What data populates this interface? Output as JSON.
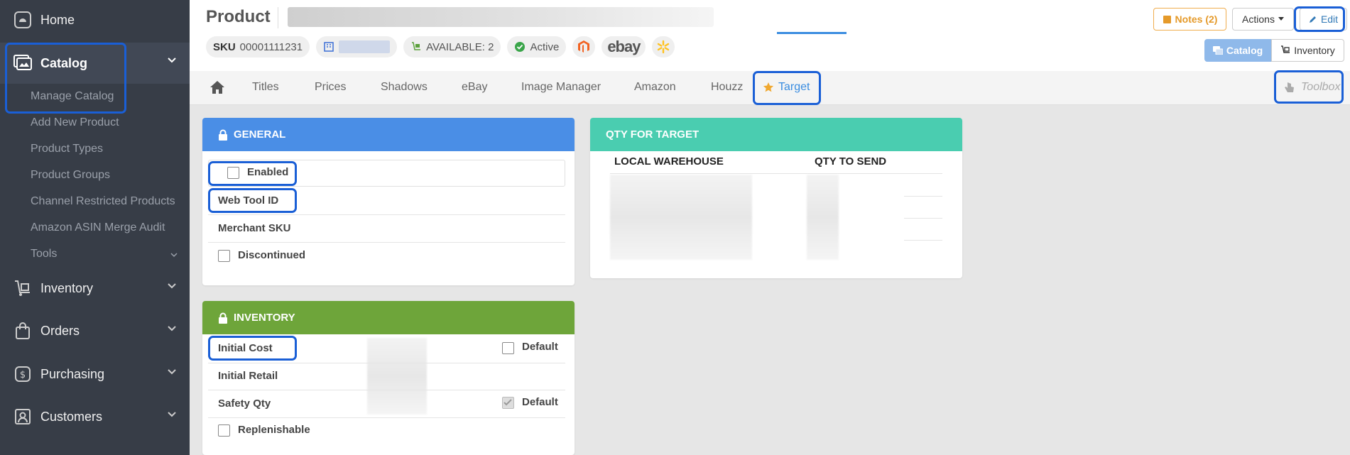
{
  "sidebar": {
    "home": "Home",
    "catalog": "Catalog",
    "catalog_items": [
      "Manage Catalog",
      "Add New Product",
      "Product Types",
      "Product Groups",
      "Channel Restricted Products",
      "Amazon ASIN Merge Audit",
      "Tools"
    ],
    "inventory": "Inventory",
    "orders": "Orders",
    "purchasing": "Purchasing",
    "customers": "Customers"
  },
  "header": {
    "title": "Product",
    "sku_label": "SKU",
    "sku_value": "00001111231",
    "available": "AVAILABLE: 2",
    "active": "Active",
    "ebay": "ebay",
    "notes": "Notes (2)",
    "actions": "Actions",
    "edit": "Edit",
    "catalog": "Catalog",
    "inventory": "Inventory"
  },
  "tabs": [
    "Titles",
    "Prices",
    "Shadows",
    "eBay",
    "Image Manager",
    "Amazon",
    "Houzz",
    "Target"
  ],
  "toolbox": "Toolbox",
  "general": {
    "title": "GENERAL",
    "enabled": "Enabled",
    "web_tool_id": "Web Tool ID",
    "merchant_sku": "Merchant SKU",
    "discontinued": "Discontinued"
  },
  "inventory_panel": {
    "title": "INVENTORY",
    "initial_cost": "Initial Cost",
    "initial_retail": "Initial Retail",
    "safety_qty": "Safety Qty",
    "replenishable": "Replenishable",
    "default": "Default"
  },
  "qty": {
    "title": "QTY FOR TARGET",
    "col1": "LOCAL WAREHOUSE",
    "col2": "QTY TO SEND"
  },
  "colors": {
    "general_head": "#4a8ee6",
    "inventory_head": "#6ea53a",
    "qty_head": "#4acdb0",
    "accent": "#3b8de0"
  }
}
